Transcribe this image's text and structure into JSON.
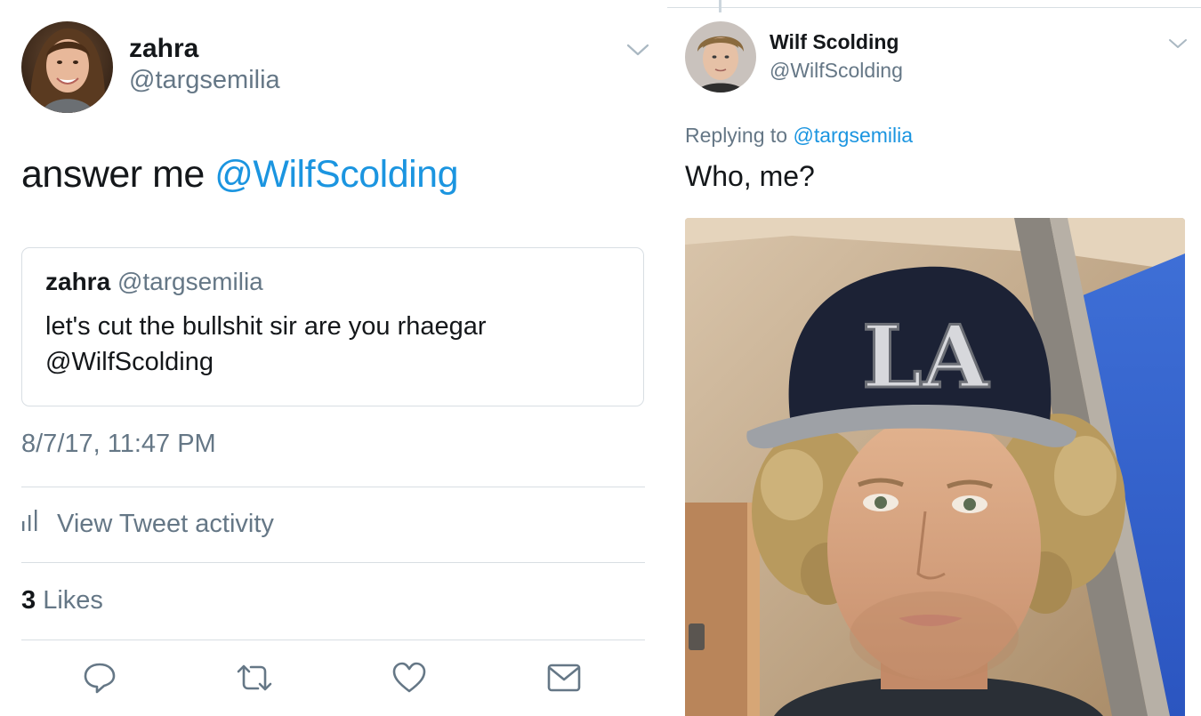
{
  "left_tweet": {
    "author": {
      "name": "zahra",
      "handle": "@targsemilia",
      "avatar": "avatar-photo"
    },
    "text": {
      "lead": "answer me ",
      "mention": "@WilfScolding"
    },
    "quoted": {
      "name": "zahra",
      "handle": "@targsemilia",
      "text": "let's cut the bullshit sir are you rhaegar @WilfScolding"
    },
    "timestamp": "8/7/17, 11:47 PM",
    "activity_label": "View Tweet activity",
    "likes": {
      "count": "3",
      "label": "Likes"
    },
    "actions": [
      {
        "name": "reply",
        "icon": "reply-icon"
      },
      {
        "name": "retweet",
        "icon": "retweet-icon"
      },
      {
        "name": "like",
        "icon": "heart-icon"
      },
      {
        "name": "direct-message",
        "icon": "envelope-icon"
      }
    ]
  },
  "right_tweet": {
    "author": {
      "name": "Wilf Scolding",
      "handle": "@WilfScolding",
      "avatar": "avatar-photo"
    },
    "replying_to": {
      "prefix": "Replying to ",
      "handle": "@targsemilia"
    },
    "text": "Who, me?",
    "photo": {
      "cap_text": "LA",
      "description_icon": "photo"
    }
  },
  "colors": {
    "link": "#1b95e0",
    "secondary_text": "#657786",
    "primary_text": "#14171a",
    "divider": "#d8dee3"
  }
}
